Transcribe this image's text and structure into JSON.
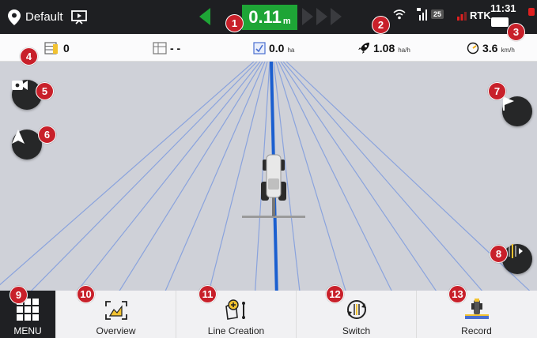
{
  "status": {
    "profile_name": "Default",
    "offset_value": "0.11",
    "offset_unit": "m",
    "satellites": "25",
    "rtk_label": "RTK",
    "time": "11:31"
  },
  "info": {
    "count_value": "0",
    "field_value": "- -",
    "area_value": "0.0",
    "area_unit": "ha",
    "rate_value": "1.08",
    "rate_unit": "ha/h",
    "speed_value": "3.6",
    "speed_unit": "km/h"
  },
  "bottom": {
    "menu_label": "MENU",
    "tabs": [
      {
        "label": "Overview"
      },
      {
        "label": "Line Creation"
      },
      {
        "label": "Switch"
      },
      {
        "label": "Record"
      }
    ]
  },
  "markers": [
    "1",
    "2",
    "3",
    "4",
    "5",
    "6",
    "7",
    "8",
    "9",
    "10",
    "11",
    "12",
    "13"
  ],
  "colors": {
    "offset_green": "#1ea536",
    "marker_red": "#c8202a",
    "guidance_blue": "#1b5fd0",
    "field_gray": "#cfd1d8"
  },
  "icons": {
    "profile": "location-pin-icon",
    "screen": "screen-icon",
    "wifi": "wifi-icon",
    "satellite": "satellite-signal-icon",
    "rtk": "rtk-icon",
    "battery": "battery-icon",
    "camera": "camera-icon",
    "navigation": "navigation-arrow-icon",
    "flag": "flag-icon",
    "center_line": "center-line-icon"
  }
}
